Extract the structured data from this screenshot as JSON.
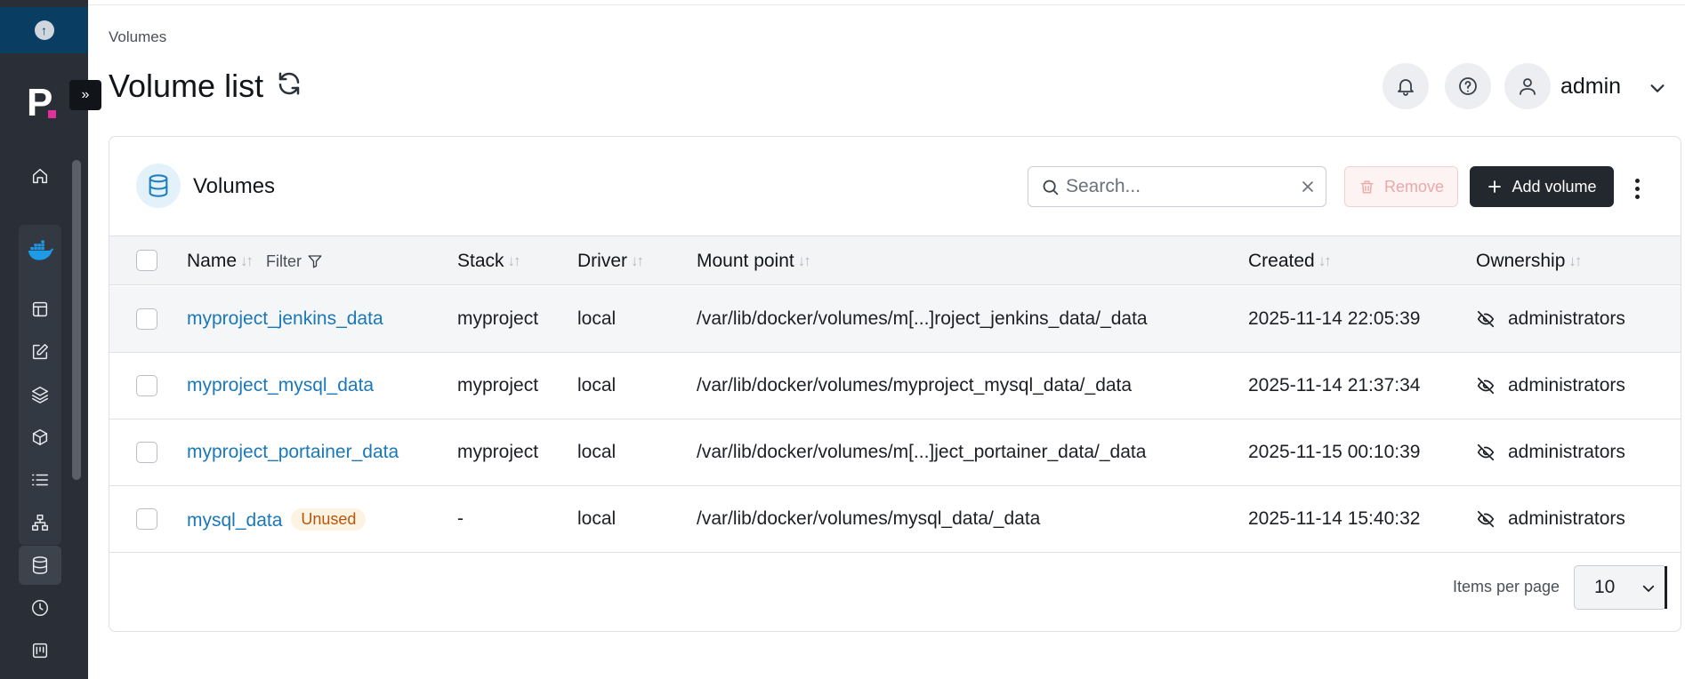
{
  "sidebar": {
    "top_icon": "upload-circle-icon",
    "logo_letter": "P",
    "expand_glyph": "»",
    "items": [
      {
        "icon": "home-icon"
      },
      {
        "icon": "docker-icon"
      },
      {
        "icon": "dashboard-icon"
      },
      {
        "icon": "edit-icon"
      },
      {
        "icon": "layers-icon"
      },
      {
        "icon": "box-icon"
      },
      {
        "icon": "list-icon"
      },
      {
        "icon": "network-icon"
      },
      {
        "icon": "database-icon",
        "active": true
      },
      {
        "icon": "clock-icon"
      },
      {
        "icon": "registry-icon"
      }
    ]
  },
  "header": {
    "breadcrumb": "Volumes",
    "title": "Volume list",
    "user": "admin",
    "icons": [
      "bell-icon",
      "help-icon",
      "user-icon"
    ]
  },
  "widget": {
    "title": "Volumes",
    "search": {
      "placeholder": "Search...",
      "value": ""
    },
    "remove_label": "Remove",
    "add_label": "Add volume"
  },
  "table": {
    "columns": {
      "name": "Name",
      "filter": "Filter",
      "stack": "Stack",
      "driver": "Driver",
      "mount": "Mount point",
      "created": "Created",
      "ownership": "Ownership"
    },
    "rows": [
      {
        "name": "myproject_jenkins_data",
        "badge": "",
        "stack": "myproject",
        "driver": "local",
        "mount": "/var/lib/docker/volumes/m[...]roject_jenkins_data/_data",
        "created": "2025-11-14 22:05:39",
        "ownership": "administrators"
      },
      {
        "name": "myproject_mysql_data",
        "badge": "",
        "stack": "myproject",
        "driver": "local",
        "mount": "/var/lib/docker/volumes/myproject_mysql_data/_data",
        "created": "2025-11-14 21:37:34",
        "ownership": "administrators"
      },
      {
        "name": "myproject_portainer_data",
        "badge": "",
        "stack": "myproject",
        "driver": "local",
        "mount": "/var/lib/docker/volumes/m[...]ject_portainer_data/_data",
        "created": "2025-11-15 00:10:39",
        "ownership": "administrators"
      },
      {
        "name": "mysql_data",
        "badge": "Unused",
        "stack": "-",
        "driver": "local",
        "mount": "/var/lib/docker/volumes/mysql_data/_data",
        "created": "2025-11-14 15:40:32",
        "ownership": "administrators"
      }
    ]
  },
  "pagination": {
    "items_per_page_label": "Items per page",
    "items_per_page": "10"
  }
}
